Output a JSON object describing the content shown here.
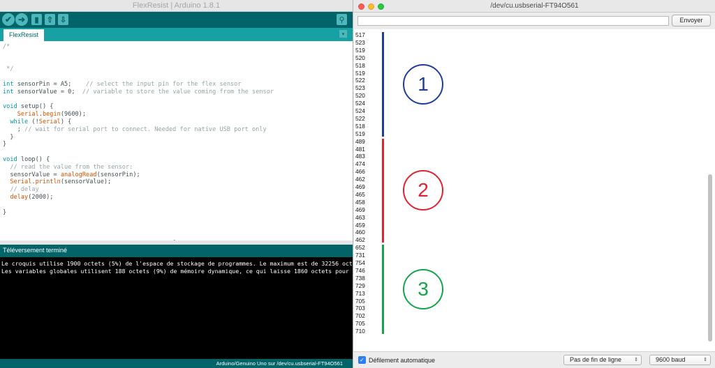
{
  "ide": {
    "title": "FlexResist | Arduino 1.8.1",
    "toolbar_icons": {
      "verify": "✔",
      "upload": "➜",
      "new": "▮",
      "open": "⇧",
      "save": "⇩",
      "serial": "⚲"
    },
    "tab": "FlexResist",
    "tab_menu_icon": "▾",
    "divider_handle": "⁃",
    "code_lines": [
      "/*",
      "",
      "",
      " */",
      "",
      "int sensorPin = A5;    // select the input pin for the flex sensor",
      "int sensorValue = 0;  // variable to store the value coming from the sensor",
      "",
      "void setup() {",
      "    Serial.begin(9600);",
      "  while (!Serial) {",
      "    ; // wait for serial port to connect. Needed for native USB port only",
      "  }",
      "}",
      "",
      "void loop() {",
      "  // read the value from the sensor:",
      "  sensorValue = analogRead(sensorPin);",
      "  Serial.println(sensorValue);",
      "  // delay",
      "  delay(2000);",
      "",
      "}"
    ],
    "status": "Téléversement terminé",
    "console_lines": [
      "Le croquis utilise 1900 octets (5%) de l'espace de stockage de programmes. Le maximum est de 32256 octets.",
      "Les variables globales utilisent 188 octets (9%) de mémoire dynamique, ce qui laisse 1860 octets pour les"
    ],
    "footer": "Arduino/Genuino Uno sur /dev/cu.usbserial-FT94O561"
  },
  "serial_monitor": {
    "title": "/dev/cu.usbserial-FT94O561",
    "send_button": "Envoyer",
    "input_value": "",
    "values": [
      "517",
      "523",
      "519",
      "520",
      "518",
      "519",
      "522",
      "523",
      "520",
      "524",
      "524",
      "522",
      "518",
      "519",
      "489",
      "481",
      "483",
      "474",
      "466",
      "462",
      "469",
      "465",
      "458",
      "469",
      "463",
      "459",
      "460",
      "462",
      "652",
      "731",
      "754",
      "746",
      "738",
      "729",
      "713",
      "705",
      "703",
      "702",
      "705",
      "710"
    ],
    "groups": [
      {
        "label": "1",
        "color": "#1f3c9e",
        "start": 0,
        "end": 13
      },
      {
        "label": "2",
        "color": "#e0242f",
        "start": 14,
        "end": 27
      },
      {
        "label": "3",
        "color": "#12a54a",
        "start": 28,
        "end": 39
      }
    ],
    "autoscroll_label": "Défilement automatique",
    "autoscroll_checked": true,
    "line_ending": "Pas de fin de ligne",
    "baud_rate": "9600 baud"
  }
}
